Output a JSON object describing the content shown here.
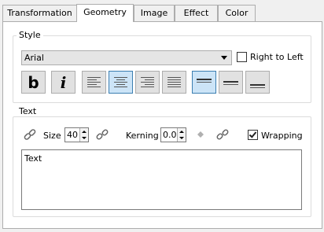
{
  "tabs": [
    {
      "label": "Transformation"
    },
    {
      "label": "Geometry"
    },
    {
      "label": "Image"
    },
    {
      "label": "Effect"
    },
    {
      "label": "Color"
    }
  ],
  "active_tab": "Geometry",
  "style_group": {
    "title": "Style",
    "font": "Arial",
    "right_to_left_label": "Right to Left",
    "right_to_left_checked": false,
    "bold_label": "b",
    "italic_label": "i",
    "align_buttons": [
      {
        "name": "align-left",
        "active": false
      },
      {
        "name": "align-center",
        "active": true
      },
      {
        "name": "align-right",
        "active": false
      },
      {
        "name": "align-justify",
        "active": false
      }
    ],
    "valign_buttons": [
      {
        "name": "valign-top",
        "active": true
      },
      {
        "name": "valign-middle",
        "active": false
      },
      {
        "name": "valign-bottom",
        "active": false
      }
    ]
  },
  "text_group": {
    "title": "Text",
    "size_label": "Size",
    "size_value": "40",
    "kerning_label": "Kerning",
    "kerning_value": "0.0",
    "wrapping_label": "Wrapping",
    "wrapping_checked": true,
    "text_value": "Text"
  },
  "colors": {
    "active_button_bg": "#cce4f7",
    "active_button_border": "#3c7fb1"
  }
}
